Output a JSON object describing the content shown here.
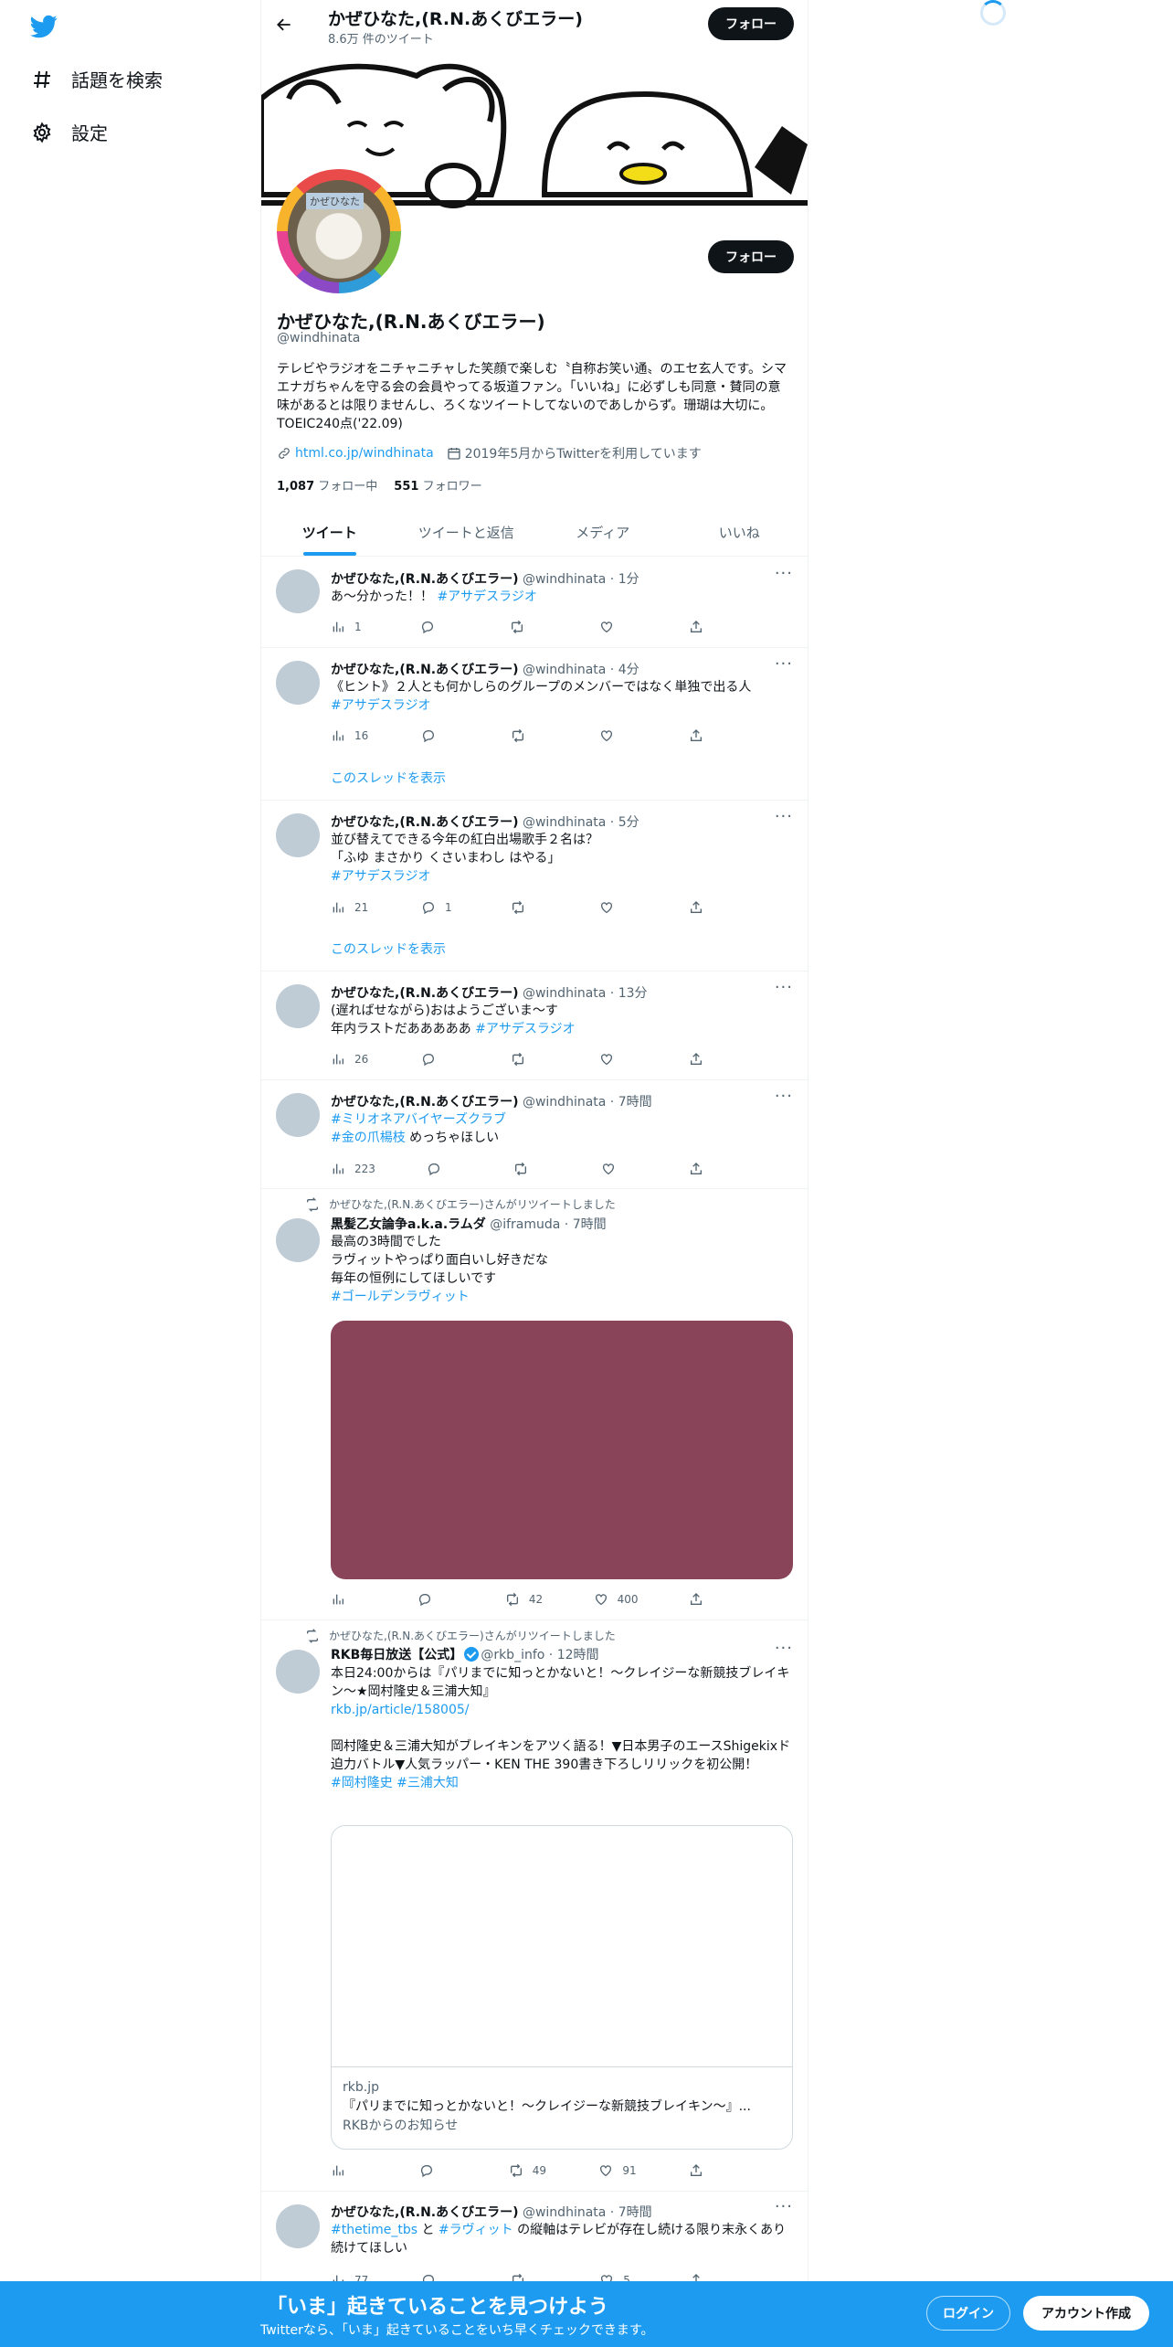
{
  "nav": {
    "explore_label": "話題を検索",
    "settings_label": "設定"
  },
  "header": {
    "title": "かぜひなた,(R.N.あくびエラー)",
    "subtitle": "8.6万 件のツイート",
    "follow_label": "フォロー"
  },
  "profile": {
    "avatar_tag": "かぜひなた",
    "follow_label": "フォロー",
    "name": "かぜひなた,(R.N.あくびエラー)",
    "handle": "@windhinata",
    "bio": "テレビやラジオをニチャニチャした笑顔で楽しむ〝自称お笑い通〟のエセ玄人です。シマエナガちゃんを守る会の会員やってる坂道ファン。「いいね」に必ずしも同意・賛同の意味があるとは限りませんし、ろくなツイートしてないのであしからず。珊瑚は大切に。TOEIC240点('22.09)",
    "link": "html.co.jp/windhinata",
    "joined": "2019年5月からTwitterを利用しています",
    "following_count": "1,087",
    "following_label": "フォロー中",
    "followers_count": "551",
    "followers_label": "フォロワー"
  },
  "tabs": [
    "ツイート",
    "ツイートと返信",
    "メディア",
    "いいね"
  ],
  "tweets": [
    {
      "name": "かぜひなた,(R.N.あくびエラー)",
      "handle": "@windhinata",
      "time": "1分",
      "text": "あ〜分かった！！ ",
      "hashtags": "#アサデスラジオ",
      "views": "1",
      "replies": "",
      "retweets": "",
      "likes": ""
    },
    {
      "name": "かぜひなた,(R.N.あくびエラー)",
      "handle": "@windhinata",
      "time": "4分",
      "text": "《ヒント》２人とも何かしらのグループのメンバーではなく単独で出る人",
      "hashtags": "#アサデスラジオ",
      "views": "16",
      "replies": "",
      "retweets": "",
      "likes": "",
      "thread": "このスレッドを表示"
    },
    {
      "name": "かぜひなた,(R.N.あくびエラー)",
      "handle": "@windhinata",
      "time": "5分",
      "text": "並び替えてできる今年の紅白出場歌手２名は？\n「ふゆ まさかり くさいまわし はやる」",
      "hashtags": "#アサデスラジオ",
      "views": "21",
      "replies": "1",
      "retweets": "",
      "likes": "",
      "thread": "このスレッドを表示"
    },
    {
      "name": "かぜひなた,(R.N.あくびエラー)",
      "handle": "@windhinata",
      "time": "13分",
      "text": "(遅ればせながら)おはようございま〜す\n年内ラストだあああああ ",
      "hashtags": "#アサデスラジオ",
      "views": "26",
      "replies": "",
      "retweets": "",
      "likes": ""
    },
    {
      "name": "かぜひなた,(R.N.あくびエラー)",
      "handle": "@windhinata",
      "time": "7時間",
      "hashtags": "#ミリオネアバイヤーズクラブ",
      "hashtags2": "#金の爪楊枝",
      "text2": " めっちゃほしい",
      "views": "223",
      "replies": "",
      "retweets": "",
      "likes": ""
    },
    {
      "rt": "かぜひなた,(R.N.あくびエラー)さんがリツイートしました",
      "name": "黒髪乙女論争a.k.a.ラムダ",
      "handle": "@iframuda",
      "time": "7時間",
      "text": "最高の3時間でした\nラヴィットやっぱり面白いし好きだな\n毎年の恒例にしてほしいです",
      "hashtags": "#ゴールデンラヴィット",
      "views": "",
      "replies": "",
      "retweets": "42",
      "likes": "400",
      "media_color": "#8a445a"
    },
    {
      "rt": "かぜひなた,(R.N.あくびエラー)さんがリツイートしました",
      "name": "RKB毎日放送【公式】",
      "handle": "@rkb_info",
      "time": "12時間",
      "text": "本日24:00からは『パリまでに知っとかないと！～クレイジーな新競技ブレイキン～★岡村隆史＆三浦大知』",
      "link": "rkb.jp/article/158005/",
      "text2": "岡村隆史＆三浦大知がブレイキンをアツく語る！▼日本男子のエースShigekixド迫力バトル▼人気ラッパー・KEN THE 390書き下ろしリリックを初公開！",
      "hashtags": "#岡村隆史 #三浦大知",
      "card_domain": "rkb.jp",
      "card_title": "『パリまでに知っとかないと！～クレイジーな新競技ブレイキン～』...",
      "card_desc": "RKBからのお知らせ",
      "views": "",
      "replies": "",
      "retweets": "49",
      "likes": "91"
    },
    {
      "name": "かぜひなた,(R.N.あくびエラー)",
      "handle": "@windhinata",
      "time": "7時間",
      "hashtagA": "#thetime_tbs",
      "mid": " と ",
      "hashtagB": "#ラヴィット",
      "text": " の縦軸はテレビが存在し続ける限り末永くあり続けてほしい",
      "views": "77",
      "replies": "",
      "retweets": "",
      "likes": "5"
    }
  ],
  "bottom": {
    "title": "「いま」起きていることを見つけよう",
    "subtitle": "Twitterなら、「いま」起きていることをいち早くチェックできます。",
    "login_label": "ログイン",
    "signup_label": "アカウント作成"
  }
}
